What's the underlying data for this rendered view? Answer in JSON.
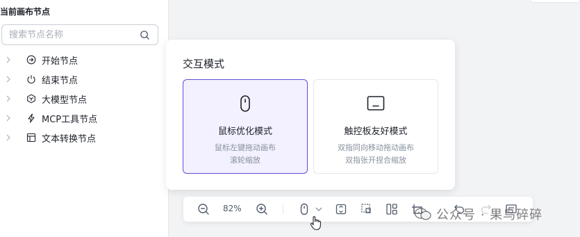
{
  "sidebar": {
    "title": "当前画布节点",
    "search": {
      "placeholder": "搜索节点名称",
      "value": ""
    },
    "nodes": [
      {
        "label": "开始节点",
        "icon": "start-node-icon"
      },
      {
        "label": "结束节点",
        "icon": "power-icon"
      },
      {
        "label": "大模型节点",
        "icon": "cube-icon"
      },
      {
        "label": "MCP工具节点",
        "icon": "lightning-icon"
      },
      {
        "label": "文本转换节点",
        "icon": "layout-icon"
      }
    ]
  },
  "interaction_popover": {
    "title": "交互模式",
    "modes": [
      {
        "name": "鼠标优化模式",
        "desc_line1": "鼠标左键拖动画布",
        "desc_line2": "滚轮缩放",
        "icon": "mouse-icon",
        "selected": true
      },
      {
        "name": "触控板友好模式",
        "desc_line1": "双指同向移动拖动画布",
        "desc_line2": "双指张开捏合缩放",
        "icon": "touchpad-icon",
        "selected": false
      }
    ]
  },
  "toolbar": {
    "zoom_level": "82%",
    "buttons": [
      "zoom-out-icon",
      "zoom-in-icon",
      "mouse-mode-icon",
      "chevron-down-icon",
      "fit-view-icon",
      "select-area-icon",
      "auto-layout-icon",
      "add-note-icon",
      "undo-icon",
      "redo-icon",
      "minimap-icon"
    ]
  },
  "watermark": {
    "text": "公众号 · 果鸟碎碎"
  },
  "colors": {
    "accent": "#5b4fd6",
    "selected_bg": "#f3f1ff",
    "border": "#e5e6eb",
    "muted_text": "#86909c"
  }
}
